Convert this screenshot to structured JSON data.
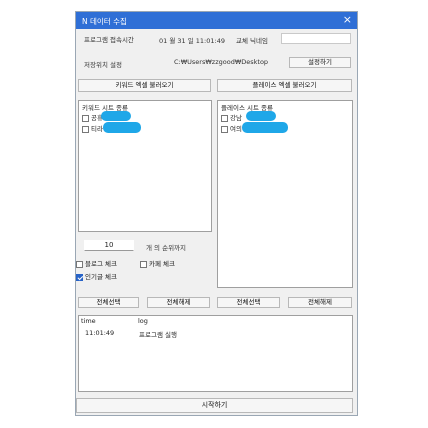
{
  "window": {
    "title": "N 데이터 수집",
    "close_icon": "×"
  },
  "header": {
    "connect_time_label": "프로그램 접속시간",
    "connect_time_value": "01 월 31 일  11:01:49",
    "nickname_label": "교체 닉네임",
    "nickname_value": ""
  },
  "save_path": {
    "label": "저장위치 설정",
    "value": "C:₩Users₩zzgood₩Desktop",
    "button": "설정하기"
  },
  "load_buttons": {
    "keyword": "키워드 엑셀 불러오기",
    "place": "플레이스 엑셀 불러오기"
  },
  "keyword_panel": {
    "header": "키워드 시트 종류",
    "items": [
      {
        "label": "공휴",
        "checked": false
      },
      {
        "label": "티라",
        "checked": false
      }
    ]
  },
  "place_panel": {
    "header": "플레이스 시트 종류",
    "items": [
      {
        "label": "강남",
        "checked": false
      },
      {
        "label": "여의",
        "checked": false
      }
    ]
  },
  "rank": {
    "value": "10",
    "suffix": "개 의 순위까지"
  },
  "options": {
    "blog": {
      "label": "블로그 체크",
      "checked": false
    },
    "cafe": {
      "label": "카페 체크",
      "checked": false
    },
    "popular": {
      "label": "인기글 체크",
      "checked": true
    }
  },
  "select_buttons": {
    "select_all_1": "전체선택",
    "deselect_all_1": "전체해제",
    "select_all_2": "전체선택",
    "deselect_all_2": "전체해제"
  },
  "log": {
    "col_time": "time",
    "col_log": "log",
    "rows": [
      {
        "time": "11:01:49",
        "message": "프로그램 실행"
      }
    ]
  },
  "start_button": "시작하기",
  "colors": {
    "titlebar": "#2f6fd6",
    "accent": "#2763c7",
    "redaction": "#1fa7e8"
  }
}
